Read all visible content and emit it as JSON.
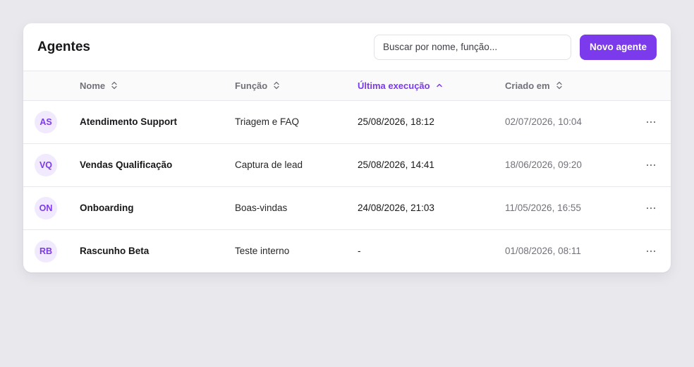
{
  "header": {
    "title": "Agentes",
    "search_placeholder": "Buscar por nome, função...",
    "search_value": "",
    "new_button_label": "Novo agente"
  },
  "columns": {
    "name": "Nome",
    "role": "Função",
    "last_run": "Última execução",
    "created": "Criado em"
  },
  "sort": {
    "column": "last_run",
    "direction": "asc"
  },
  "colors": {
    "accent": "#7c3aed",
    "avatar_bg": "#f1e9fe",
    "page_bg": "#e9e8ed"
  },
  "rows": [
    {
      "initials": "AS",
      "name": "Atendimento Support",
      "role": "Triagem e FAQ",
      "last_run": "25/08/2026, 18:12",
      "created": "02/07/2026, 10:04"
    },
    {
      "initials": "VQ",
      "name": "Vendas Qualificação",
      "role": "Captura de lead",
      "last_run": "25/08/2026, 14:41",
      "created": "18/06/2026, 09:20"
    },
    {
      "initials": "ON",
      "name": "Onboarding",
      "role": "Boas-vindas",
      "last_run": "24/08/2026, 21:03",
      "created": "11/05/2026, 16:55"
    },
    {
      "initials": "RB",
      "name": "Rascunho Beta",
      "role": "Teste interno",
      "last_run": "-",
      "created": "01/08/2026, 08:11"
    }
  ],
  "icons": {
    "sort_neutral": "sort-both-icon",
    "sort_asc": "sort-up-icon",
    "row_menu": "more-horizontal-icon"
  }
}
